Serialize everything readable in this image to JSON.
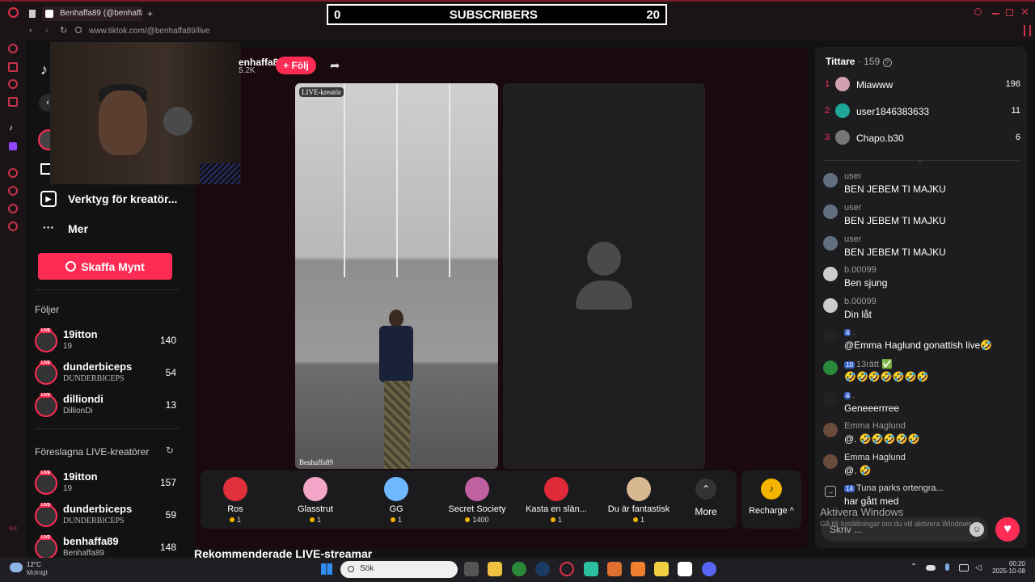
{
  "browser": {
    "tabs": [
      {
        "label": ""
      },
      {
        "label": "Benhaffa89 (@benhaffa"
      }
    ],
    "new_tab": "+",
    "url_host": "www.tiktok.com",
    "url_path": "/@benhaffa89/live"
  },
  "overlay": {
    "sub_left": "0",
    "sub_label": "SUBSCRIBERS",
    "sub_right": "20"
  },
  "nav": {
    "creator_tools": "Verktyg för kreatör...",
    "more": "Mer",
    "get_coins": "Skaffa Mynt",
    "following_title": "Följer",
    "following": [
      {
        "name": "19itton",
        "sub": "19",
        "count": "140"
      },
      {
        "name": "dunderbiceps",
        "sub": "DUNDERBICEPS",
        "count": "54"
      },
      {
        "name": "dilliondi",
        "sub": "DillionDi",
        "count": "13"
      }
    ],
    "suggested_title": "Föreslagna LIVE-kreatörer",
    "suggested": [
      {
        "name": "19itton",
        "sub": "19",
        "count": "157"
      },
      {
        "name": "dunderbiceps",
        "sub": "DUNDERBICEPS",
        "count": "59"
      },
      {
        "name": "benhaffa89",
        "sub": "Benhaffa89",
        "count": "148"
      }
    ],
    "live_badge": "LIVE",
    "gx_label": "GX"
  },
  "host": {
    "name": "enhaffa89",
    "likes": "5.2K",
    "follow_label": "+ Följ"
  },
  "video": {
    "creator_tag": "LIVE-kreatör",
    "username": "Benhaffa89"
  },
  "gifts": [
    {
      "name": "Ros",
      "price": "1",
      "color": "#e0303c"
    },
    {
      "name": "Glasstrut",
      "price": "1",
      "color": "#f3a6c8"
    },
    {
      "name": "GG",
      "price": "1",
      "color": "#6fb7ff"
    },
    {
      "name": "Secret Society",
      "price": "1400",
      "color": "#c060a0"
    },
    {
      "name": "Kasta en slän...",
      "price": "1",
      "color": "#e02a3a"
    },
    {
      "name": "Du är fantastisk",
      "price": "1",
      "color": "#d8b890"
    }
  ],
  "more_label": "More",
  "recharge_label": "Recharge ^",
  "recommended_title": "Rekommenderade LIVE-streamar",
  "viewers": {
    "title": "Tittare",
    "count": "· 159",
    "top": [
      {
        "rank": "1",
        "name": "Miawww",
        "score": "196"
      },
      {
        "rank": "2",
        "name": "user1846383633",
        "score": "11"
      },
      {
        "rank": "3",
        "name": "Chapo.b30",
        "score": "6"
      }
    ]
  },
  "chat": [
    {
      "name": "user",
      "text": "BEN JEBEM TI MAJKU",
      "badge": ""
    },
    {
      "name": "user",
      "text": "BEN JEBEM TI MAJKU",
      "badge": ""
    },
    {
      "name": "user",
      "text": "BEN JEBEM TI MAJKU",
      "badge": ""
    },
    {
      "name": "b.00099",
      "text": "Ben sjung",
      "badge": ""
    },
    {
      "name": "b.00099",
      "text": "Din låt",
      "badge": ""
    },
    {
      "name": ".",
      "text": "@Emma Haglund gonattish live🤣",
      "badge": "4"
    },
    {
      "name": "13rätt ✅",
      "text": "🤣🤣🤣🤣🤣🤣🤣",
      "badge": "10"
    },
    {
      "name": ".",
      "text": "Geneeerrree",
      "badge": "4"
    },
    {
      "name": "Emma Haglund",
      "text": "@. 🤣🤣🤣🤣🤣",
      "badge": ""
    },
    {
      "name": "Emma Haglund",
      "text": "@. 🤣",
      "badge": ""
    },
    {
      "name": "Tuna parks ortengra...",
      "text": "har gått med",
      "badge": "14"
    }
  ],
  "activate": {
    "title": "Aktivera Windows",
    "sub": "Gå till Inställningar om du vill aktivera Windows."
  },
  "chat_placeholder": "Skriv ...",
  "taskbar": {
    "temp": "12°C",
    "weather": "Molnigt",
    "search": "Sök",
    "time": "00:20",
    "date": "2025-10-08"
  }
}
